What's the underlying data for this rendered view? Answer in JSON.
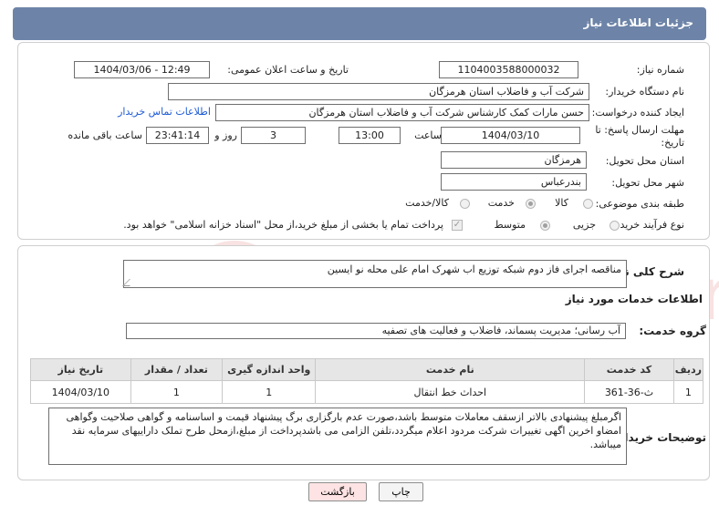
{
  "header": {
    "title": "جزئیات اطلاعات نیاز"
  },
  "form": {
    "need_number_label": "شماره نیاز:",
    "need_number": "1104003588000032",
    "announce_datetime_label": "تاریخ و ساعت اعلان عمومی:",
    "announce_datetime": "1404/03/06 - 12:49",
    "buyer_org_label": "نام دستگاه خریدار:",
    "buyer_org": "شرکت آب و فاضلاب استان هرمزگان",
    "requester_label": "ایجاد کننده درخواست:",
    "requester": "حسن مارات کمک کارشناس شرکت آب و فاضلاب استان هرمزگان",
    "contact_link": "اطلاعات تماس خریدار",
    "deadline_label": "مهلت ارسال پاسخ: تا تاریخ:",
    "deadline_date": "1404/03/10",
    "time_label": "ساعت",
    "deadline_time": "13:00",
    "days_value": "3",
    "days_label": "روز و",
    "remaining_time": "23:41:14",
    "remaining_label": "ساعت باقی مانده",
    "province_label": "استان محل تحویل:",
    "province": "هرمزگان",
    "city_label": "شهر محل تحویل:",
    "city": "بندرعباس",
    "category_label": "طبقه بندی موضوعی:",
    "category_options": [
      "کالا",
      "خدمت",
      "کالا/خدمت"
    ],
    "category_selected": "خدمت",
    "process_label": "نوع فرآیند خرید :",
    "process_options": [
      "جزیی",
      "متوسط"
    ],
    "process_selected": "متوسط",
    "treasury_note": "پرداخت تمام یا بخشی از مبلغ خرید،از محل \"اسناد خزانه اسلامی\" خواهد بود."
  },
  "details": {
    "summary_label": "شرح کلی نیاز:",
    "summary": "مناقصه اجرای فاز دوم شبکه توزیع اب شهرک امام علی محله نو ایسین",
    "services_section_title": "اطلاعات خدمات مورد نیاز",
    "service_group_label": "گروه خدمت:",
    "service_group": "آب رسانی؛ مدیریت پسماند، فاضلاب و فعالیت های تصفیه",
    "table": {
      "headers": [
        "ردیف",
        "کد خدمت",
        "نام خدمت",
        "واحد اندازه گیری",
        "تعداد / مقدار",
        "تاریخ نیاز"
      ],
      "rows": [
        [
          "1",
          "ث-36-361",
          "احداث خط انتقال",
          "1",
          "1",
          "1404/03/10"
        ]
      ]
    },
    "buyer_notes_label": "توضیحات خریدار:",
    "buyer_notes": "اگرمبلغ پیشنهادی بالاتر ازسقف معاملات متوسط باشد،صورت عدم بارگزاری برگ پیشنهاد قیمت و اساسنامه و گواهی صلاحیت وگواهی امضاو اخرین اگهی تغییرات شرکت مردود اعلام میگردد،تلفن الزامی می باشدپرداخت از مبلغ،ازمحل طرح تملک داراییهای سرمایه نقد میباشد."
  },
  "buttons": {
    "print": "چاپ",
    "back": "بازگشت"
  },
  "watermark": {
    "text": "AriaTender.net"
  },
  "colors": {
    "titlebar": "#6d84a8",
    "link": "#1e5bd6",
    "back_button": "#fde3e3",
    "print_button": "#f4f4f4"
  }
}
